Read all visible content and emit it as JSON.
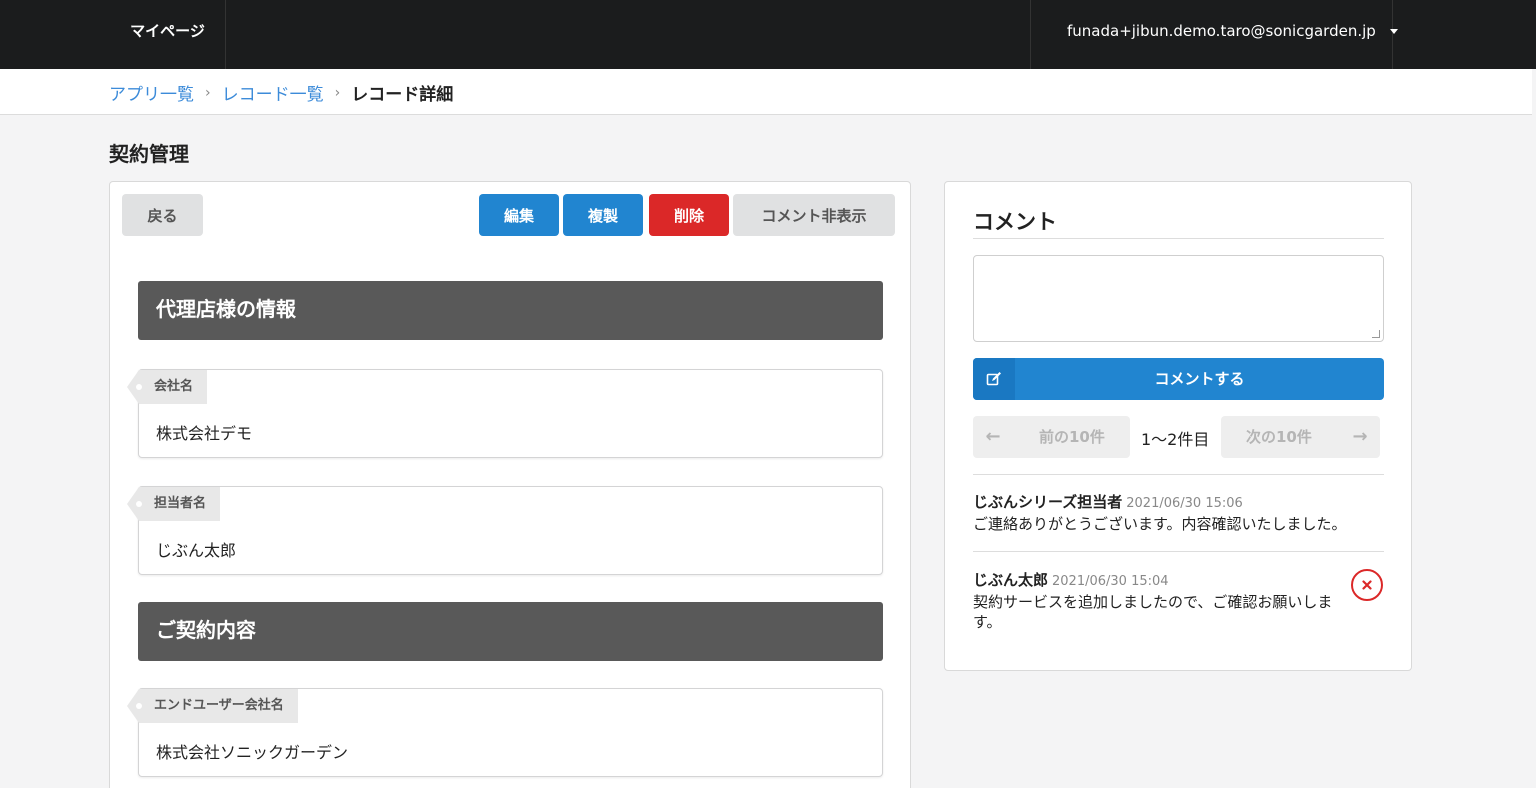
{
  "header": {
    "brand": "マイページ",
    "user_email": "funada+jibun.demo.taro@sonicgarden.jp"
  },
  "breadcrumb": {
    "items": [
      "アプリ一覧",
      "レコード一覧"
    ],
    "current": "レコード詳細"
  },
  "page": {
    "title": "契約管理"
  },
  "toolbar": {
    "back_label": "戻る",
    "edit_label": "編集",
    "duplicate_label": "複製",
    "delete_label": "削除",
    "hide_comments_label": "コメント非表示"
  },
  "record": {
    "sections": [
      {
        "title": "代理店様の情報",
        "fields": [
          {
            "label": "会社名",
            "value": "株式会社デモ"
          },
          {
            "label": "担当者名",
            "value": "じぶん太郎"
          }
        ]
      },
      {
        "title": "ご契約内容",
        "fields": [
          {
            "label": "エンドユーザー会社名",
            "value": "株式会社ソニックガーデン"
          }
        ]
      }
    ]
  },
  "comments": {
    "title": "コメント",
    "input_placeholder": "",
    "submit_label": "コメントする",
    "prev_label": "前の10件",
    "next_label": "次の10件",
    "range_label": "1〜2件目",
    "items": [
      {
        "author": "じぶんシリーズ担当者",
        "date": "2021/06/30 15:06",
        "text": "ご連絡ありがとうございます。内容確認いたしました。"
      },
      {
        "author": "じぶん太郎",
        "date": "2021/06/30 15:04",
        "text": "契約サービスを追加しましたので、ご確認お願いします。"
      }
    ]
  },
  "colors": {
    "primary": "#2185d0",
    "danger": "#db2828",
    "header_bg": "#1b1c1d",
    "section_bg": "#595959",
    "link": "#3c8bd9"
  }
}
